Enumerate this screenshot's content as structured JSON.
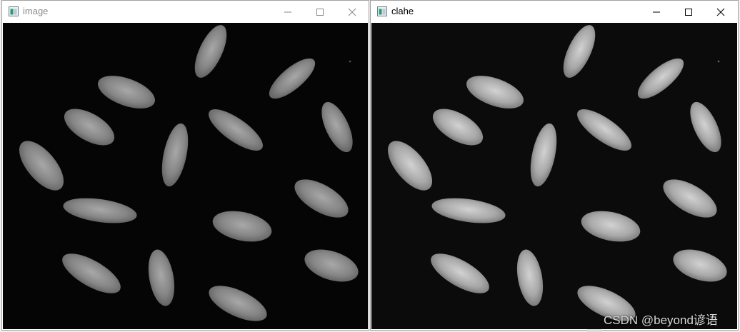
{
  "windows": [
    {
      "title": "image",
      "state": "inactive"
    },
    {
      "title": "clahe",
      "state": "active"
    }
  ],
  "controls": [
    "minimize-icon",
    "maximize-icon",
    "close-icon"
  ],
  "watermark": "CSDN @beyond谚语",
  "colors": {
    "grain_image": "#8c8c8c",
    "grain_clahe": "#b4b4b4",
    "background_image": "#050505",
    "background_clahe": "#0b0b0b"
  }
}
